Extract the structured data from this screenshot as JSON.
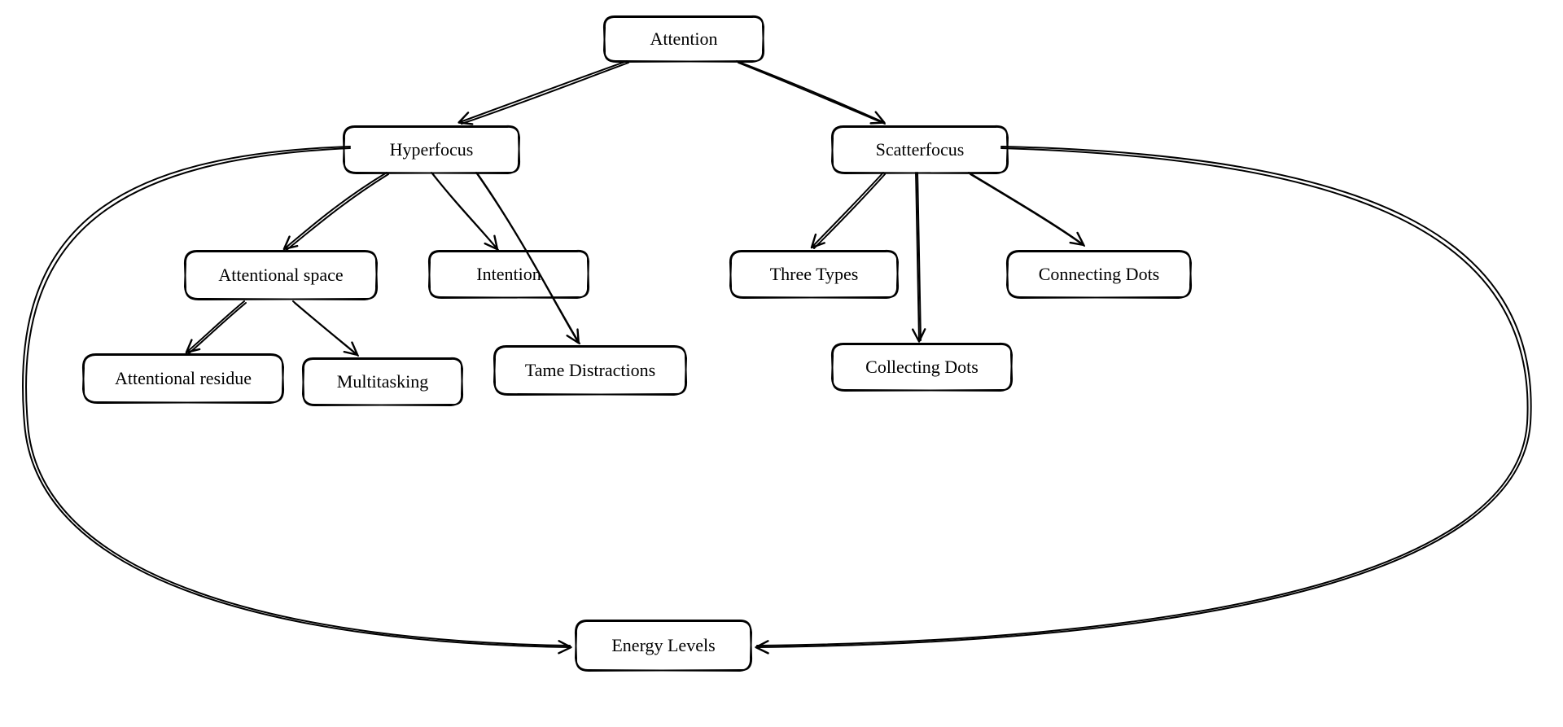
{
  "nodes": {
    "attention": {
      "label": "Attention"
    },
    "hyperfocus": {
      "label": "Hyperfocus"
    },
    "scatterfocus": {
      "label": "Scatterfocus"
    },
    "attentional_space": {
      "label": "Attentional space"
    },
    "intention": {
      "label": "Intention"
    },
    "tame_distractions": {
      "label": "Tame Distractions"
    },
    "attentional_residue": {
      "label": "Attentional residue"
    },
    "multitasking": {
      "label": "Multitasking"
    },
    "three_types": {
      "label": "Three Types"
    },
    "collecting_dots": {
      "label": "Collecting Dots"
    },
    "connecting_dots": {
      "label": "Connecting Dots"
    },
    "energy_levels": {
      "label": "Energy Levels"
    }
  },
  "edges": [
    [
      "attention",
      "hyperfocus"
    ],
    [
      "attention",
      "scatterfocus"
    ],
    [
      "hyperfocus",
      "attentional_space"
    ],
    [
      "hyperfocus",
      "intention"
    ],
    [
      "hyperfocus",
      "tame_distractions"
    ],
    [
      "attentional_space",
      "attentional_residue"
    ],
    [
      "attentional_space",
      "multitasking"
    ],
    [
      "scatterfocus",
      "three_types"
    ],
    [
      "scatterfocus",
      "collecting_dots"
    ],
    [
      "scatterfocus",
      "connecting_dots"
    ],
    [
      "hyperfocus",
      "energy_levels"
    ],
    [
      "scatterfocus",
      "energy_levels"
    ]
  ]
}
